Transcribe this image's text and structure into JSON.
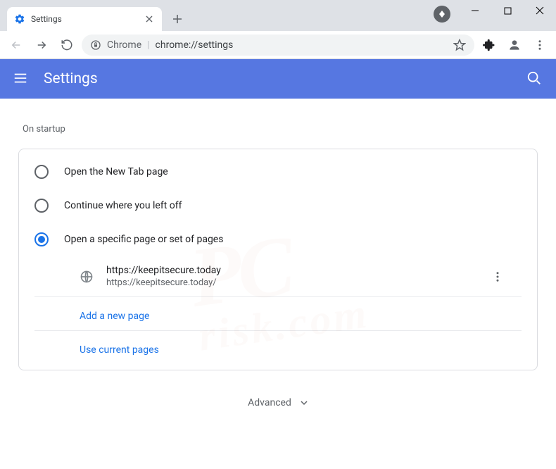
{
  "window": {
    "tab_title": "Settings"
  },
  "omnibox": {
    "chip": "Chrome",
    "url": "chrome://settings"
  },
  "header": {
    "title": "Settings"
  },
  "section": {
    "title": "On startup",
    "options": [
      {
        "label": "Open the New Tab page"
      },
      {
        "label": "Continue where you left off"
      },
      {
        "label": "Open a specific page or set of pages"
      }
    ],
    "pages": [
      {
        "title": "https://keepitsecure.today",
        "url": "https://keepitsecure.today/"
      }
    ],
    "add_link": "Add a new page",
    "use_current_link": "Use current pages"
  },
  "advanced": {
    "label": "Advanced"
  }
}
